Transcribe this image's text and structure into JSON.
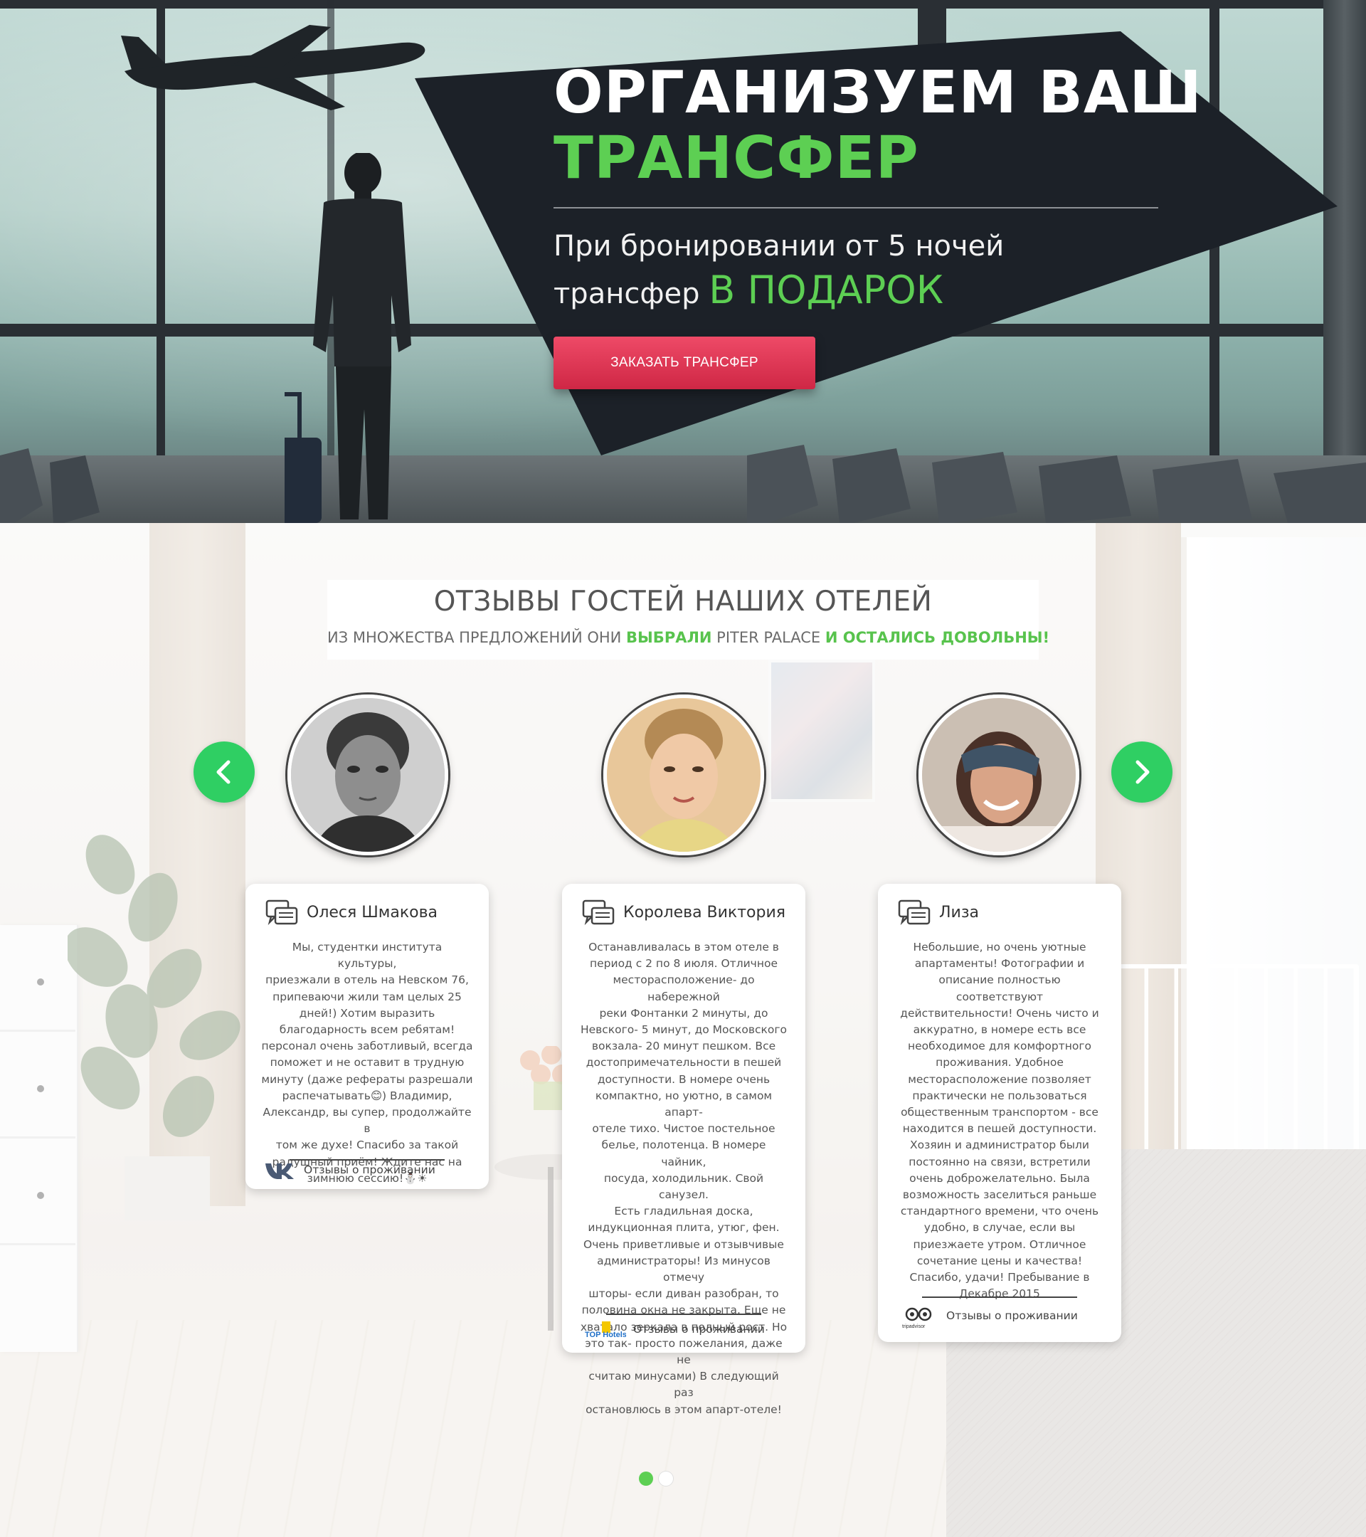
{
  "hero": {
    "title_line1": "ОРГАНИЗУЕМ ВАШ",
    "title_line2": "ТРАНСФЕР",
    "subtitle_line1": "При бронировании от 5 ночей",
    "subtitle_line2_prefix": "трансфер",
    "subtitle_line2_accent": "В ПОДАРОК",
    "button_label": "ЗАКАЗАТЬ ТРАНСФЕР"
  },
  "reviews": {
    "title": "ОТЗЫВЫ ГОСТЕЙ НАШИХ ОТЕЛЕЙ",
    "subtitle_part1": "ИЗ МНОЖЕСТВА ПРЕДЛОЖЕНИЙ ОНИ ",
    "subtitle_part2": "ВЫБРАЛИ",
    "subtitle_part3": " PITER PALACE ",
    "subtitle_part4": "И ОСТАЛИСЬ ДОВОЛЬНЫ!",
    "items": [
      {
        "name": "Олеся Шмакова",
        "lines": [
          "Мы, студентки института культуры,",
          "приезжали в отель на Невском 76,",
          "припеваючи жили там целых 25",
          "дней!) Хотим выразить",
          "благодарность всем ребятам!",
          "персонал очень заботливый, всегда",
          "поможет и не оставит в трудную",
          "минуту (даже рефераты разрешали",
          "распечатывать😊) Владимир,",
          "Александр, вы супер, продолжайте в",
          "том же духе! Спасибо за такой",
          "радушный приём! Ждите нас на",
          "зимнюю сессию!⛄☀"
        ],
        "source_label": "Отзывы о проживании",
        "source_icon": "vk-icon"
      },
      {
        "name": "Королева Виктория",
        "lines": [
          "Останавливалась в этом отеле в",
          "период с 2 по 8 июля. Отличное",
          "месторасположение- до набережной",
          "реки Фонтанки 2 минуты, до",
          "Невского- 5 минут, до Московского",
          "вокзала- 20 минут пешком. Все",
          "достопримечательности в пешей",
          "доступности. В номере очень",
          "компактно, но уютно, в самом апарт-",
          "отеле тихо. Чистое постельное",
          "белье, полотенца. В номере чайник,",
          "посуда, холодильник. Свой санузел.",
          "Есть гладильная доска,",
          "индукционная плита, утюг, фен.",
          "Очень приветливые и отзывчивые",
          "администраторы! Из минусов отмечу",
          "шторы- если диван разобран, то",
          "половина окна не закрыта. Еще не",
          "хватало зеркала в полный рост. Но",
          "это так- просто пожелания, даже не",
          "считаю минусами) В следующий раз",
          "остановлюсь в этом апарт-отеле!"
        ],
        "source_label": "Отзывы о проживании",
        "source_icon": "tophotels-icon",
        "source_logo_text": "TOP Hotels"
      },
      {
        "name": "Лиза",
        "lines": [
          "Небольшие, но очень уютные",
          "апартаменты! Фотографии и",
          "описание полностью соответствуют",
          "действительности! Очень чисто и",
          "аккуратно, в номере есть все",
          "необходимое для комфортного",
          "проживания. Удобное",
          "месторасположение позволяет",
          "практически не пользоваться",
          "общественным транспортом - все",
          "находится в пешей доступности.",
          "Хозяин и администратор были",
          "постоянно на связи, встретили",
          "очень доброжелательно. Была",
          "возможность заселиться раньше",
          "стандартного времени, что очень",
          "удобно, в случае, если вы",
          "приезжаете утром. Отличное",
          "сочетание цены и качества!",
          "Спасибо, удачи! Пребывание в",
          "Декабре 2015"
        ],
        "source_label": "Отзывы о проживании",
        "source_icon": "tripadvisor-icon",
        "source_logo_text": "tripadvisor"
      }
    ],
    "slides_total": 2,
    "active_slide": 1
  },
  "colors": {
    "accent_green": "#5dcf53",
    "arrow_green": "#2fcf63",
    "button_red": "#e03a57",
    "panel_dark": "#1c2128"
  }
}
